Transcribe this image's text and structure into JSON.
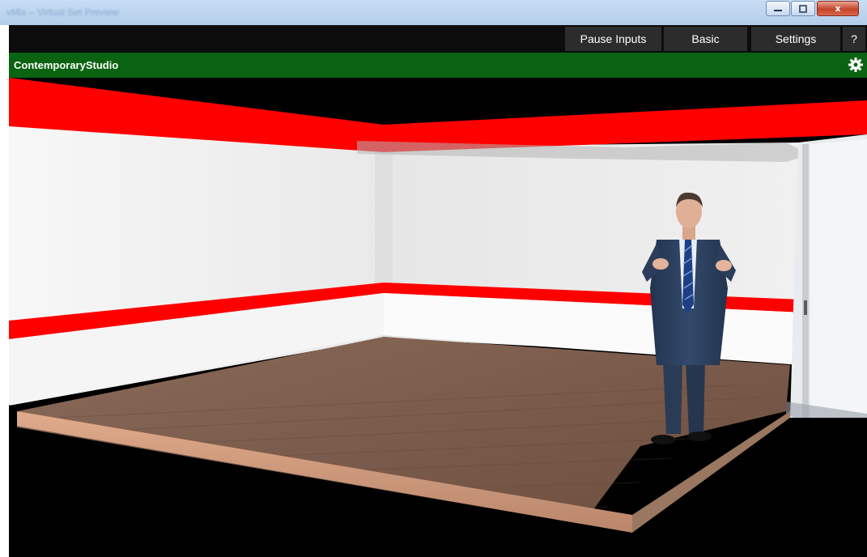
{
  "window": {
    "title": "vMix – Virtual Set Preview",
    "controls": {
      "minimize_icon": "minimize-icon",
      "maximize_icon": "maximize-icon",
      "close_label": "x"
    }
  },
  "toolbar": {
    "pause_inputs": "Pause Inputs",
    "basic": "Basic",
    "settings": "Settings",
    "help": "?"
  },
  "scene": {
    "title": "ContemporaryStudio",
    "settings_icon": "gear-icon",
    "header_color": "#0a6310"
  },
  "colors": {
    "stripe_red": "#ff0000",
    "wall_white": "#f2f2f2",
    "floor_wood": "#7a5a4a",
    "background": "#000000"
  }
}
